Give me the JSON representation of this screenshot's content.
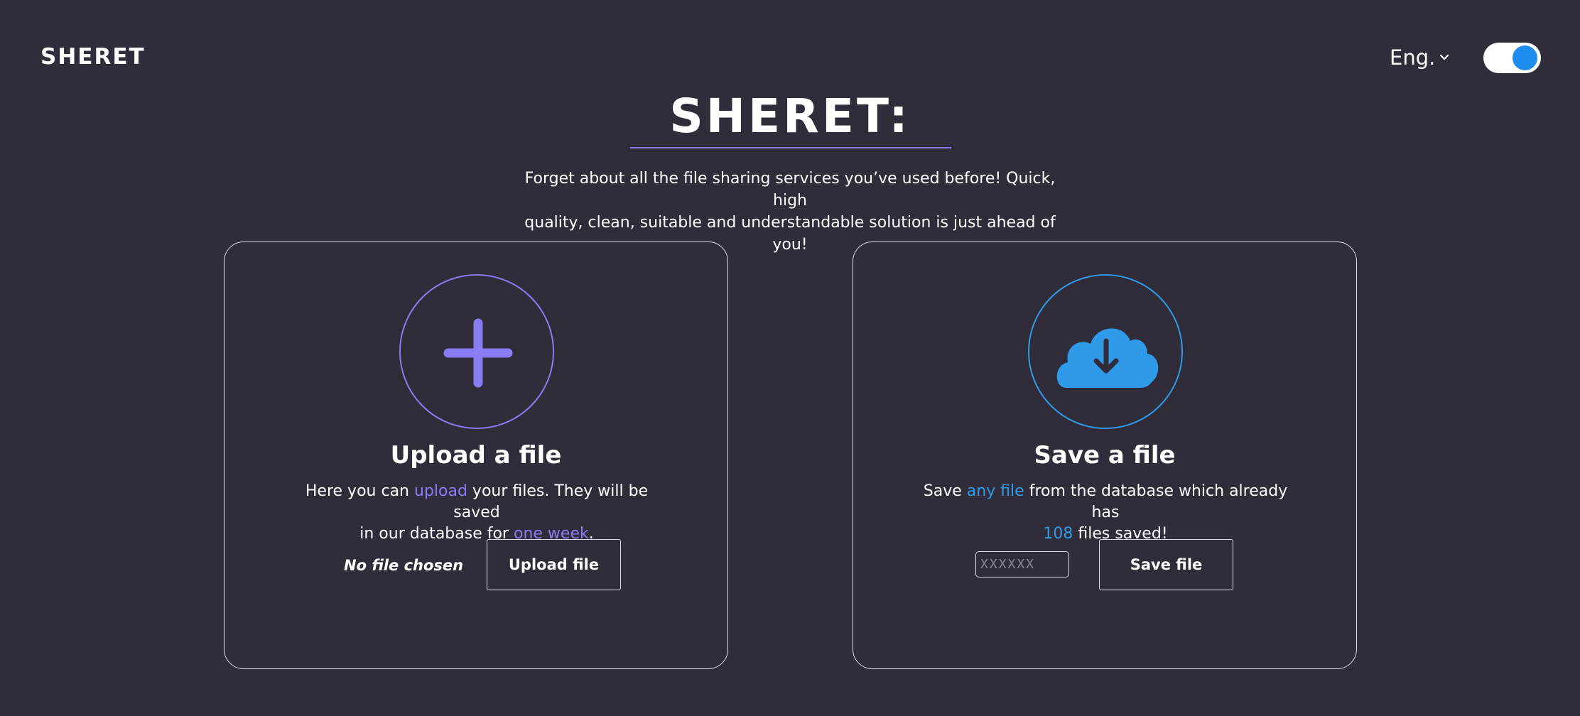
{
  "header": {
    "logo": "SHERET",
    "language": "Eng.",
    "theme_toggle_on": true
  },
  "hero": {
    "title": "SHERET:",
    "tagline_line1": "Forget about all the file sharing services you’ve used before! Quick, high",
    "tagline_line2": "quality, clean, suitable and understandable solution is just ahead of you!"
  },
  "upload_card": {
    "icon": "plus-icon",
    "title": "Upload a file",
    "desc_part1": "Here you can ",
    "desc_hl1": "upload",
    "desc_part2": " your files. They will be saved",
    "desc_part3": "in our database for ",
    "desc_hl2": "one week",
    "desc_part4": ".",
    "no_file_text": "No file chosen",
    "button_label": "Upload file"
  },
  "save_card": {
    "icon": "cloud-download-icon",
    "title": "Save a file",
    "desc_part1": "Save ",
    "desc_hl1": "any file",
    "desc_part2": " from the database which already has",
    "desc_count": "108",
    "desc_part3": " files saved!",
    "code_placeholder": "XXXXXX",
    "code_value": "",
    "button_label": "Save file"
  },
  "colors": {
    "background": "#302c3a",
    "accent_purple": "#8a7cf2",
    "accent_blue": "#2f9ae8",
    "toggle_knob": "#1f8cf0"
  }
}
